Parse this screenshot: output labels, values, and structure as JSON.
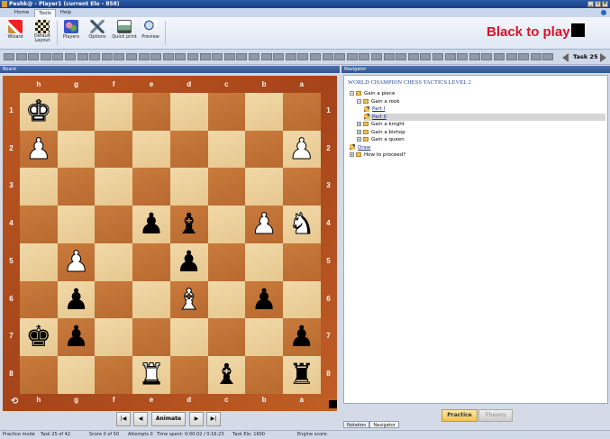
{
  "window": {
    "title": "Peshk@ - Player1 (current Elo - 858)"
  },
  "menu": {
    "tabs": [
      "Home",
      "Tools",
      "Help"
    ]
  },
  "ribbon": {
    "buttons": [
      {
        "label": "Wizard",
        "icon": "wizard-icon"
      },
      {
        "label": "Default Layout",
        "icon": "layout-icon"
      },
      {
        "label": "Players",
        "icon": "players-icon"
      },
      {
        "label": "Options",
        "icon": "options-icon"
      },
      {
        "label": "Quick print",
        "icon": "print-icon"
      },
      {
        "label": "Preview",
        "icon": "preview-icon"
      }
    ]
  },
  "status_to_move": "Black to play",
  "task": {
    "label": "Task 25",
    "squares": 45
  },
  "panels": {
    "board": "Board",
    "navigator": "Navigator"
  },
  "board": {
    "files": [
      "h",
      "g",
      "f",
      "e",
      "d",
      "c",
      "b",
      "a"
    ],
    "ranks": [
      "1",
      "2",
      "3",
      "4",
      "5",
      "6",
      "7",
      "8"
    ],
    "pieces": [
      {
        "sq": "h1",
        "p": "♚",
        "c": "w"
      },
      {
        "sq": "h2",
        "p": "♟",
        "c": "w"
      },
      {
        "sq": "a2",
        "p": "♟",
        "c": "w"
      },
      {
        "sq": "e4",
        "p": "♟",
        "c": "b"
      },
      {
        "sq": "d4",
        "p": "♝",
        "c": "b"
      },
      {
        "sq": "b4",
        "p": "♟",
        "c": "w"
      },
      {
        "sq": "a4",
        "p": "♞",
        "c": "w"
      },
      {
        "sq": "g5",
        "p": "♟",
        "c": "w"
      },
      {
        "sq": "d5",
        "p": "♟",
        "c": "b"
      },
      {
        "sq": "g6",
        "p": "♟",
        "c": "b"
      },
      {
        "sq": "d6",
        "p": "♝",
        "c": "w"
      },
      {
        "sq": "b6",
        "p": "♟",
        "c": "b"
      },
      {
        "sq": "h7",
        "p": "♚",
        "c": "b"
      },
      {
        "sq": "g7",
        "p": "♟",
        "c": "b"
      },
      {
        "sq": "a7",
        "p": "♟",
        "c": "b"
      },
      {
        "sq": "e8",
        "p": "♜",
        "c": "w"
      },
      {
        "sq": "c8",
        "p": "♝",
        "c": "b"
      },
      {
        "sq": "a8",
        "p": "♜",
        "c": "b"
      }
    ]
  },
  "controls": {
    "animate": "Animate"
  },
  "navigator": {
    "title": "WORLD CHAMPION CHESS TACTICS LEVEL 2",
    "tree": [
      {
        "label": "Gain a piece",
        "icon": "folder",
        "level": 0,
        "toggle": "−"
      },
      {
        "label": "Gain a rook",
        "icon": "folder",
        "level": 1,
        "toggle": "−"
      },
      {
        "label": "Part I",
        "icon": "pencil",
        "level": 2,
        "link": true
      },
      {
        "label": "Part II",
        "icon": "pencil",
        "level": 2,
        "link": true,
        "selected": true
      },
      {
        "label": "Gain a knight",
        "icon": "folder",
        "level": 1,
        "toggle": "+"
      },
      {
        "label": "Gain a bishop",
        "icon": "folder",
        "level": 1,
        "toggle": "+"
      },
      {
        "label": "Gain a queen",
        "icon": "folder",
        "level": 1,
        "toggle": "+"
      },
      {
        "label": "Draw",
        "icon": "pencil",
        "level": 0,
        "link": true
      },
      {
        "label": "How to proceed?",
        "icon": "folder",
        "level": 0,
        "toggle": "+"
      }
    ],
    "practice": "Practice",
    "theory": "Theory",
    "bottom_tabs": [
      "Notation",
      "Navigator"
    ]
  },
  "statusbar": {
    "mode": "Practice mode",
    "task": "Task 25 of 42",
    "score": "Score 0 of 50",
    "attempts": "Attempts 0",
    "time": "Time spent: 0:00:02 / 0:16:23",
    "task_elo": "Task Elo: 1600",
    "engine": "Engine score:"
  }
}
